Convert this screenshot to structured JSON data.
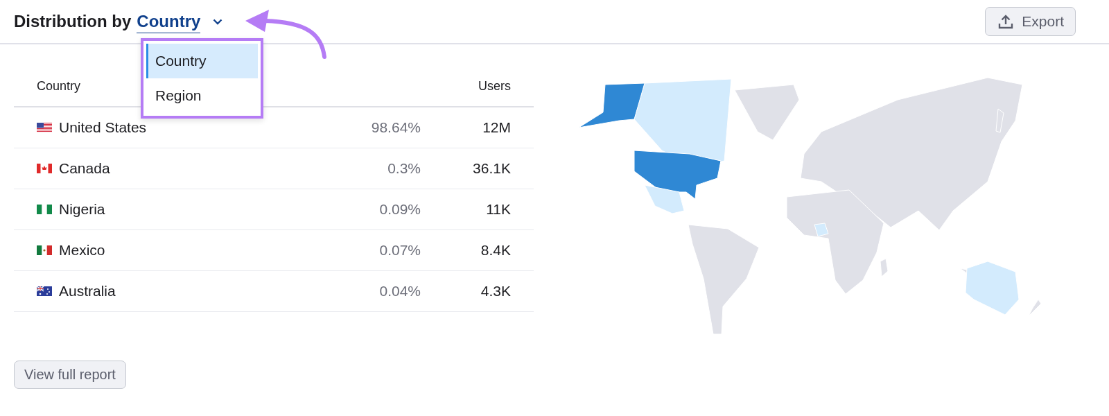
{
  "header": {
    "title": "Distribution by",
    "dimension": "Country"
  },
  "dropdown": {
    "options": [
      {
        "label": "Country",
        "selected": true
      },
      {
        "label": "Region",
        "selected": false
      }
    ]
  },
  "export_button": "Export",
  "table": {
    "columns": [
      "Country",
      "Users"
    ],
    "rows": [
      {
        "kind": "us",
        "country": "United States",
        "share": "98.64%",
        "users": "12M"
      },
      {
        "kind": "ca",
        "country": "Canada",
        "share": "0.3%",
        "users": "36.1K"
      },
      {
        "kind": "ng",
        "country": "Nigeria",
        "share": "0.09%",
        "users": "11K"
      },
      {
        "kind": "mx",
        "country": "Mexico",
        "share": "0.07%",
        "users": "8.4K"
      },
      {
        "kind": "au",
        "country": "Australia",
        "share": "0.04%",
        "users": "4.3K"
      }
    ]
  },
  "footer_button": "View full report"
}
